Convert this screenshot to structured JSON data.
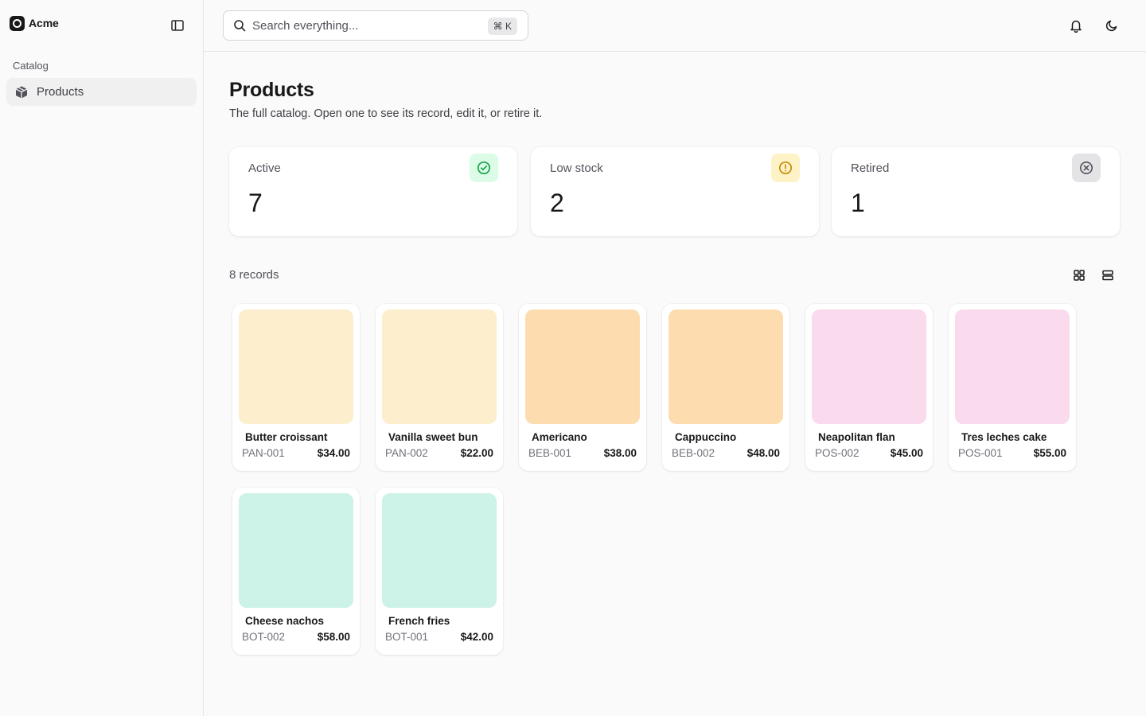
{
  "app": {
    "brand_name": "Acme"
  },
  "sidebar": {
    "group_label": "Catalog",
    "items": [
      {
        "label": "Products",
        "icon": "package-icon",
        "active": true
      }
    ]
  },
  "header": {
    "search": {
      "placeholder": "Search everything...",
      "shortcut": "⌘ K"
    },
    "icons": [
      "bell-icon",
      "moon-icon"
    ]
  },
  "page": {
    "title": "Products",
    "subtitle": "The full catalog. Open one to see its record, edit it, or retire it."
  },
  "stats": [
    {
      "label": "Active",
      "value": "7",
      "icon": "check-circle-icon",
      "color": "#16a34a",
      "bg": "#dcfce7"
    },
    {
      "label": "Low stock",
      "value": "2",
      "icon": "alert-circle-icon",
      "color": "#ca8a04",
      "bg": "#fef3c7"
    },
    {
      "label": "Retired",
      "value": "1",
      "icon": "x-circle-icon",
      "color": "#52525b",
      "bg": "#e4e4e7"
    }
  ],
  "records": {
    "count_label": "8 records",
    "view_icons": [
      "grid-view-icon",
      "list-view-icon"
    ]
  },
  "products": [
    {
      "name": "Butter croissant",
      "sku": "PAN-001",
      "price": "$34.00",
      "color": "#fdeecd"
    },
    {
      "name": "Vanilla sweet bun",
      "sku": "PAN-002",
      "price": "$22.00",
      "color": "#fdeecd"
    },
    {
      "name": "Americano",
      "sku": "BEB-001",
      "price": "$38.00",
      "color": "#fddcb0"
    },
    {
      "name": "Cappuccino",
      "sku": "BEB-002",
      "price": "$48.00",
      "color": "#fddcb0"
    },
    {
      "name": "Neapolitan flan",
      "sku": "POS-002",
      "price": "$45.00",
      "color": "#fadaed"
    },
    {
      "name": "Tres leches cake",
      "sku": "POS-001",
      "price": "$55.00",
      "color": "#fadaed"
    },
    {
      "name": "Cheese nachos",
      "sku": "BOT-002",
      "price": "$58.00",
      "color": "#cdf2e8"
    },
    {
      "name": "French fries",
      "sku": "BOT-001",
      "price": "$42.00",
      "color": "#cdf2e8"
    }
  ]
}
